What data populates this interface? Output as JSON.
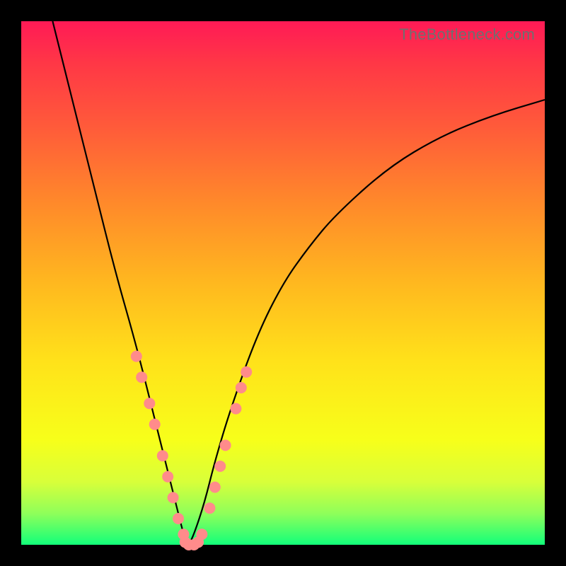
{
  "watermark": "TheBottleneck.com",
  "chart_data": {
    "type": "line",
    "title": "",
    "xlabel": "",
    "ylabel": "",
    "xlim": [
      0,
      100
    ],
    "ylim": [
      0,
      100
    ],
    "background_gradient": {
      "top": "#ff1a56",
      "bottom": "#12ff7a",
      "stops": [
        "#ff1a56",
        "#ff3746",
        "#ff5a3a",
        "#ff8a2a",
        "#ffb81f",
        "#ffe21a",
        "#f7ff1a",
        "#d8ff3a",
        "#8fff5a",
        "#12ff7a"
      ]
    },
    "curve": {
      "description": "Steep V-shaped bottleneck curve; left branch falls from top-left to a minimum near x≈32, right branch rises with decreasing slope toward top-right.",
      "x": [
        6,
        10,
        14,
        18,
        22,
        26,
        28,
        30,
        31,
        32,
        33,
        35,
        37,
        40,
        45,
        50,
        55,
        60,
        70,
        80,
        90,
        100
      ],
      "y": [
        100,
        84,
        68,
        52,
        38,
        22,
        14,
        6,
        2,
        0,
        2,
        8,
        16,
        26,
        40,
        50,
        57,
        63,
        72,
        78,
        82,
        85
      ]
    },
    "markers": {
      "description": "Pink dot clusters along both branches near the V and at the trough.",
      "points": [
        {
          "x": 22,
          "y": 36
        },
        {
          "x": 23,
          "y": 32
        },
        {
          "x": 24.5,
          "y": 27
        },
        {
          "x": 25.5,
          "y": 23
        },
        {
          "x": 27,
          "y": 17
        },
        {
          "x": 28,
          "y": 13
        },
        {
          "x": 29,
          "y": 9
        },
        {
          "x": 30,
          "y": 5
        },
        {
          "x": 31,
          "y": 2
        },
        {
          "x": 31.3,
          "y": 0.5
        },
        {
          "x": 32,
          "y": 0
        },
        {
          "x": 33,
          "y": 0
        },
        {
          "x": 33.8,
          "y": 0.5
        },
        {
          "x": 34.5,
          "y": 2
        },
        {
          "x": 36,
          "y": 7
        },
        {
          "x": 37,
          "y": 11
        },
        {
          "x": 38,
          "y": 15
        },
        {
          "x": 39,
          "y": 19
        },
        {
          "x": 41,
          "y": 26
        },
        {
          "x": 42,
          "y": 30
        },
        {
          "x": 43,
          "y": 33
        }
      ],
      "color": "#ff8b8b",
      "radius_px": 8
    }
  }
}
